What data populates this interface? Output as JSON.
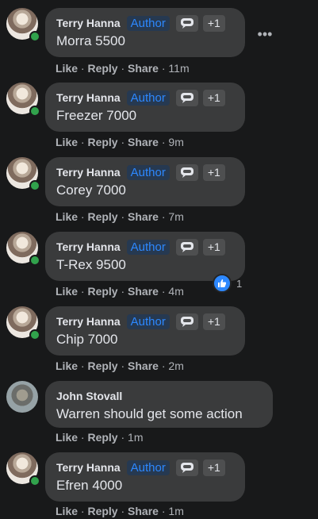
{
  "comments": [
    {
      "name": "Terry Hanna",
      "author": "Author",
      "badge_count": "+1",
      "text": "Morra 5500",
      "like": "Like",
      "reply": "Reply",
      "share": "Share",
      "time": "11m"
    },
    {
      "name": "Terry Hanna",
      "author": "Author",
      "badge_count": "+1",
      "text": "Freezer 7000",
      "like": "Like",
      "reply": "Reply",
      "share": "Share",
      "time": "9m"
    },
    {
      "name": "Terry Hanna",
      "author": "Author",
      "badge_count": "+1",
      "text": "Corey 7000",
      "like": "Like",
      "reply": "Reply",
      "share": "Share",
      "time": "7m"
    },
    {
      "name": "Terry Hanna",
      "author": "Author",
      "badge_count": "+1",
      "text": "T-Rex 9500",
      "like": "Like",
      "reply": "Reply",
      "share": "Share",
      "time": "4m",
      "reaction_count": "1"
    },
    {
      "name": "Terry Hanna",
      "author": "Author",
      "badge_count": "+1",
      "text": "Chip 7000",
      "like": "Like",
      "reply": "Reply",
      "share": "Share",
      "time": "2m"
    },
    {
      "name": "John Stovall",
      "text": "Warren should get some action",
      "like": "Like",
      "reply": "Reply",
      "time": "1m"
    },
    {
      "name": "Terry Hanna",
      "author": "Author",
      "badge_count": "+1",
      "text": "Efren 4000",
      "like": "Like",
      "reply": "Reply",
      "share": "Share",
      "time": "1m"
    }
  ],
  "icons": {
    "more": "more-options-icon",
    "badge": "comment-badge-icon",
    "reaction": "like-reaction-icon"
  },
  "colors": {
    "background": "#18191a",
    "bubble": "#3a3b3c",
    "author": "#2d88ff",
    "online": "#31a24c"
  }
}
